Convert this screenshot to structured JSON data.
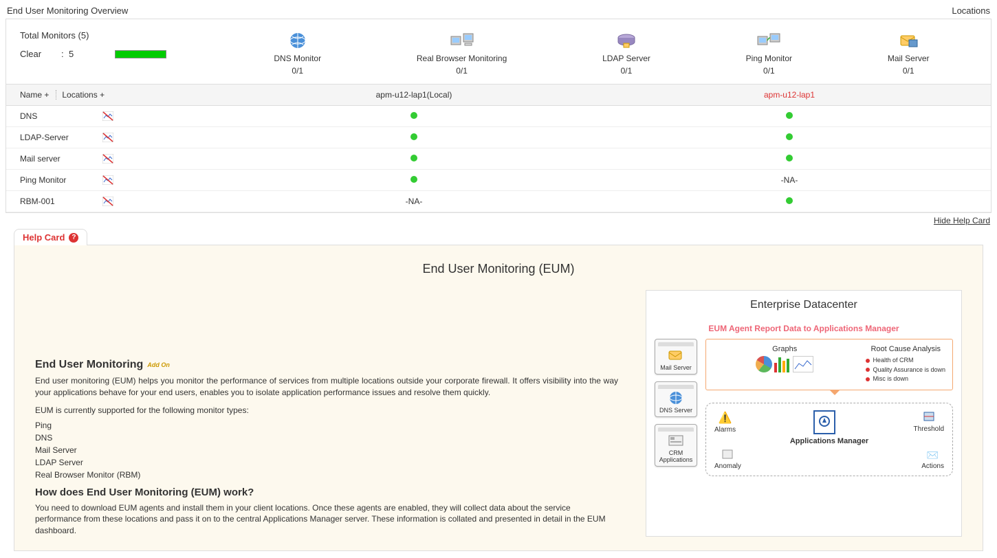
{
  "header": {
    "title": "End User Monitoring Overview",
    "locations_link": "Locations"
  },
  "summary": {
    "total_label": "Total Monitors (5)",
    "clear_label": "Clear",
    "clear_separator": ":",
    "clear_count": "5"
  },
  "monitor_types": [
    {
      "name": "DNS Monitor",
      "count": "0/1"
    },
    {
      "name": "Real Browser Monitoring",
      "count": "0/1"
    },
    {
      "name": "LDAP Server",
      "count": "0/1"
    },
    {
      "name": "Ping Monitor",
      "count": "0/1"
    },
    {
      "name": "Mail Server",
      "count": "0/1"
    }
  ],
  "table": {
    "name_header": "Name +",
    "locations_header": "Locations +",
    "location_columns": [
      {
        "label": "apm-u12-lap1(Local)",
        "warn": false
      },
      {
        "label": "apm-u12-lap1",
        "warn": true
      }
    ],
    "rows": [
      {
        "name": "DNS",
        "cells": [
          "up",
          "up"
        ]
      },
      {
        "name": "LDAP-Server",
        "cells": [
          "up",
          "up"
        ]
      },
      {
        "name": "Mail server",
        "cells": [
          "up",
          "up"
        ]
      },
      {
        "name": "Ping Monitor",
        "cells": [
          "up",
          "-NA-"
        ]
      },
      {
        "name": "RBM-001",
        "cells": [
          "-NA-",
          "up"
        ]
      }
    ]
  },
  "hide_help_label": "Hide Help Card",
  "helpcard": {
    "tab_label": "Help Card",
    "main_title": "End User Monitoring (EUM)",
    "subtitle": "Enterprise Datacenter",
    "section_heading": "End User Monitoring",
    "addon_label": "Add On",
    "intro": "End user monitoring (EUM) helps you monitor the performance of services from multiple locations outside your corporate firewall. It offers visibility into the way your applications behave for your end users, enables you to isolate application performance issues and resolve them quickly.",
    "supported_intro": "EUM is currently supported for the following monitor types:",
    "supported_types": [
      "Ping",
      "DNS",
      "Mail Server",
      "LDAP Server",
      "Real Browser Monitor (RBM)"
    ],
    "how_heading": "How does End User Monitoring (EUM) work?",
    "how_text": "You need to download EUM agents and install them in your client locations. Once these agents are enabled, they will collect data about the service performance from these locations and pass it on to the central Applications Manager server. These information is collated and presented in detail in the EUM dashboard.",
    "diagram": {
      "title": "EUM Agent Report Data to Applications Manager",
      "left_boxes": [
        {
          "label": "Mail Server"
        },
        {
          "label": "DNS Server"
        },
        {
          "label": "CRM Applications"
        }
      ],
      "graphs_label": "Graphs",
      "rca_label": "Root Cause Analysis",
      "rca_items": [
        "Health of CRM",
        "Quality Assurance is down",
        "Misc is down"
      ],
      "appmgr": {
        "alarms": "Alarms",
        "threshold": "Threshold",
        "anomaly": "Anomaly",
        "actions": "Actions",
        "title": "Applications Manager"
      }
    }
  }
}
